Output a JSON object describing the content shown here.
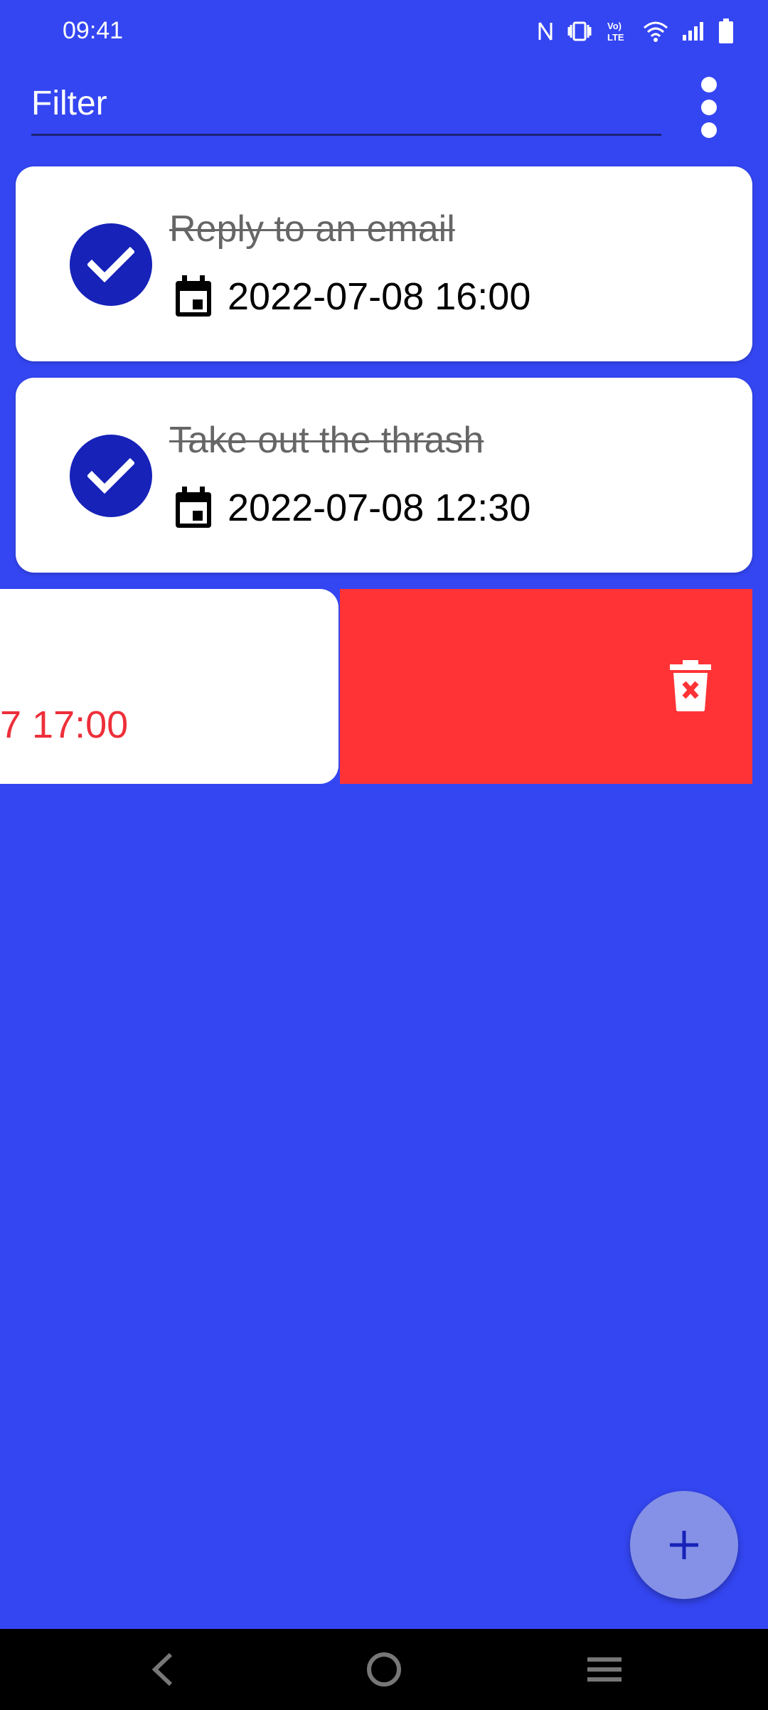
{
  "status_bar": {
    "time": "09:41",
    "icons": [
      "nfc-icon",
      "vibrate-icon",
      "volte-icon",
      "wifi-icon",
      "signal-icon",
      "battery-icon"
    ]
  },
  "filter": {
    "placeholder": "Filter",
    "value": ""
  },
  "menu": {
    "icon": "more-vert-icon"
  },
  "tasks": [
    {
      "title": "Reply to an email",
      "date": "2022-07-08 16:00",
      "done": true
    },
    {
      "title": "Take out the thrash",
      "date": "2022-07-08 12:30",
      "done": true
    }
  ],
  "swiped_task": {
    "date_fragment": "7 17:00",
    "delete_icon": "trash-icon"
  },
  "fab": {
    "label": "+"
  },
  "colors": {
    "background": "#3446f2",
    "check": "#1622b8",
    "delete": "#ff3336",
    "overdue": "#ee2f3a",
    "fab": "#8591e6"
  },
  "nav": [
    "back-icon",
    "home-icon",
    "recents-icon"
  ]
}
